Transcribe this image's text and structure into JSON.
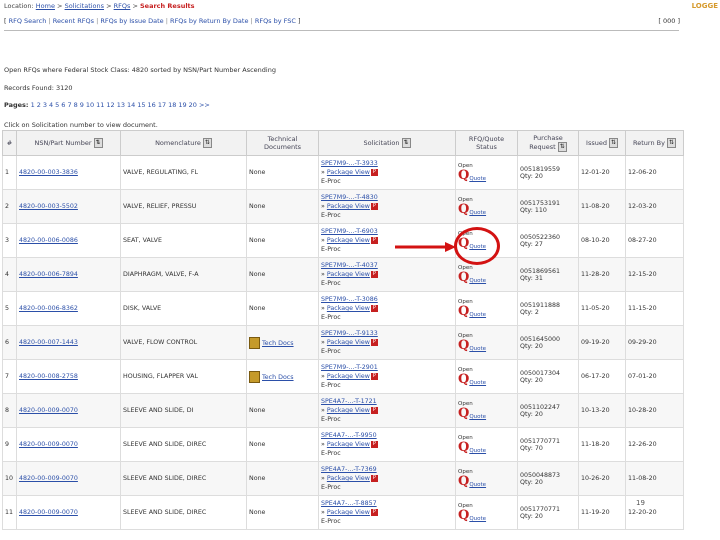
{
  "header": {
    "location_label": "Location:",
    "breadcrumbs": [
      "Home",
      "Solicitations",
      "RFQs",
      "Search Results"
    ],
    "logo": "LOGGE"
  },
  "nav": {
    "items": [
      "RFQ Search",
      "Recent RFQs",
      "RFQs by Issue Date",
      "RFQs by Return By Date",
      "RFQs by FSC"
    ],
    "fsc_value": "[ 000 ]"
  },
  "results": {
    "title": "Open RFQs where Federal Stock Class: 4820 sorted by NSN/Part Number Ascending",
    "records_found": "Records Found: 3120",
    "pages_label": "Pages:",
    "pages": [
      "1",
      "2",
      "3",
      "4",
      "5",
      "6",
      "7",
      "8",
      "9",
      "10",
      "11",
      "12",
      "13",
      "14",
      "15",
      "16",
      "17",
      "18",
      "19",
      "20",
      ">>"
    ],
    "click_info": "Click on Solicitation number to view document."
  },
  "table": {
    "headers": [
      "#",
      "NSN/Part Number",
      "Nomenclature",
      "Technical Documents",
      "Solicitation",
      "RFQ/Quote Status",
      "Purchase Request",
      "Issued",
      "Return By"
    ],
    "rows": [
      {
        "num": "1",
        "nsn": "4820-00-003-3836",
        "nom": "VALVE, REGULATING, FL",
        "tech": "None",
        "sol": "SPE7M9-...-T-3933",
        "pkg": "Package View",
        "extra": "E-Proc",
        "status": "Open",
        "quote": "Quote",
        "pr": "0051819559",
        "qty": "Qty: 20",
        "issued": "12-01-20",
        "ret": "12-06-20"
      },
      {
        "num": "2",
        "nsn": "4820-00-003-5502",
        "nom": "VALVE, RELIEF, PRESSU",
        "tech": "None",
        "sol": "SPE7M9-...-T-4830",
        "pkg": "Package View",
        "extra": "E-Proc",
        "status": "Open",
        "quote": "Quote",
        "pr": "0051753191",
        "qty": "Qty: 110",
        "issued": "11-08-20",
        "ret": "12-03-20"
      },
      {
        "num": "3",
        "nsn": "4820-00-006-0086",
        "nom": "SEAT, VALVE",
        "tech": "None",
        "sol": "SPE7M9-...-T-6903",
        "pkg": "Package View",
        "extra": "E-Proc",
        "status": "Open",
        "quote": "Quote",
        "pr": "0050522360",
        "qty": "Qty: 27",
        "issued": "08-10-20",
        "ret": "08-27-20"
      },
      {
        "num": "4",
        "nsn": "4820-00-006-7894",
        "nom": "DIAPHRAGM, VALVE, F-A",
        "tech": "None",
        "sol": "SPE7M9-...-T-4037",
        "pkg": "Package View",
        "extra": "E-Proc",
        "status": "Open",
        "quote": "Quote",
        "pr": "0051869561",
        "qty": "Qty: 31",
        "issued": "11-28-20",
        "ret": "12-15-20"
      },
      {
        "num": "5",
        "nsn": "4820-00-006-8362",
        "nom": "DISK, VALVE",
        "tech": "None",
        "sol": "SPE7M9-...-T-3086",
        "pkg": "Package View",
        "extra": "E-Proc",
        "status": "Open",
        "quote": "Quote",
        "pr": "0051911888",
        "qty": "Qty: 2",
        "issued": "11-05-20",
        "ret": "11-15-20"
      },
      {
        "num": "6",
        "nsn": "4820-00-007-1443",
        "nom": "VALVE, FLOW CONTROL",
        "tech": "Tech Docs",
        "sol": "SPE7M9-...-T-9133",
        "pkg": "Package View",
        "extra": "E-Proc",
        "status": "Open",
        "quote": "Quote",
        "pr": "0051645000",
        "qty": "Qty: 20",
        "issued": "09-19-20",
        "ret": "09-29-20"
      },
      {
        "num": "7",
        "nsn": "4820-00-008-2758",
        "nom": "HOUSING, FLAPPER VAL",
        "tech": "Tech Docs",
        "sol": "SPE7M9-...-T-2901",
        "pkg": "Package View",
        "extra": "E-Proc",
        "status": "Open",
        "quote": "Quote",
        "pr": "0050017304",
        "qty": "Qty: 20",
        "issued": "06-17-20",
        "ret": "07-01-20"
      },
      {
        "num": "8",
        "nsn": "4820-00-009-0070",
        "nom": "SLEEVE AND SLIDE, DI",
        "tech": "None",
        "sol": "SPE4A7-...-T-1721",
        "pkg": "Package View",
        "extra": "E-Proc",
        "status": "Open",
        "quote": "Quote",
        "pr": "0051102247",
        "qty": "Qty: 20",
        "issued": "10-13-20",
        "ret": "10-28-20"
      },
      {
        "num": "9",
        "nsn": "4820-00-009-0070",
        "nom": "SLEEVE AND SLIDE, DIREC",
        "tech": "None",
        "sol": "SPE4A7-...-T-9950",
        "pkg": "Package View",
        "extra": "E-Proc",
        "status": "Open",
        "quote": "Quote",
        "pr": "0051770771",
        "qty": "Qty: 70",
        "issued": "11-18-20",
        "ret": "12-26-20"
      },
      {
        "num": "10",
        "nsn": "4820-00-009-0070",
        "nom": "SLEEVE AND SLIDE, DIREC",
        "tech": "None",
        "sol": "SPE4A7-...-T-7369",
        "pkg": "Package View",
        "extra": "E-Proc",
        "status": "Open",
        "quote": "Quote",
        "pr": "0050048873",
        "qty": "Qty: 20",
        "issued": "10-26-20",
        "ret": "11-08-20"
      },
      {
        "num": "11",
        "nsn": "4820-00-009-0070",
        "nom": "SLEEVE AND SLIDE, DIREC",
        "tech": "None",
        "sol": "SPE4A7-...-T-8857",
        "pkg": "Package View",
        "extra": "E-Proc",
        "status": "Open",
        "quote": "Quote",
        "pr": "0051770771",
        "qty": "Qty: 20",
        "issued": "11-19-20",
        "ret": "12-20-20"
      }
    ]
  },
  "annotation": {
    "color": "#d31212"
  },
  "footer": {
    "page_number": "19"
  }
}
